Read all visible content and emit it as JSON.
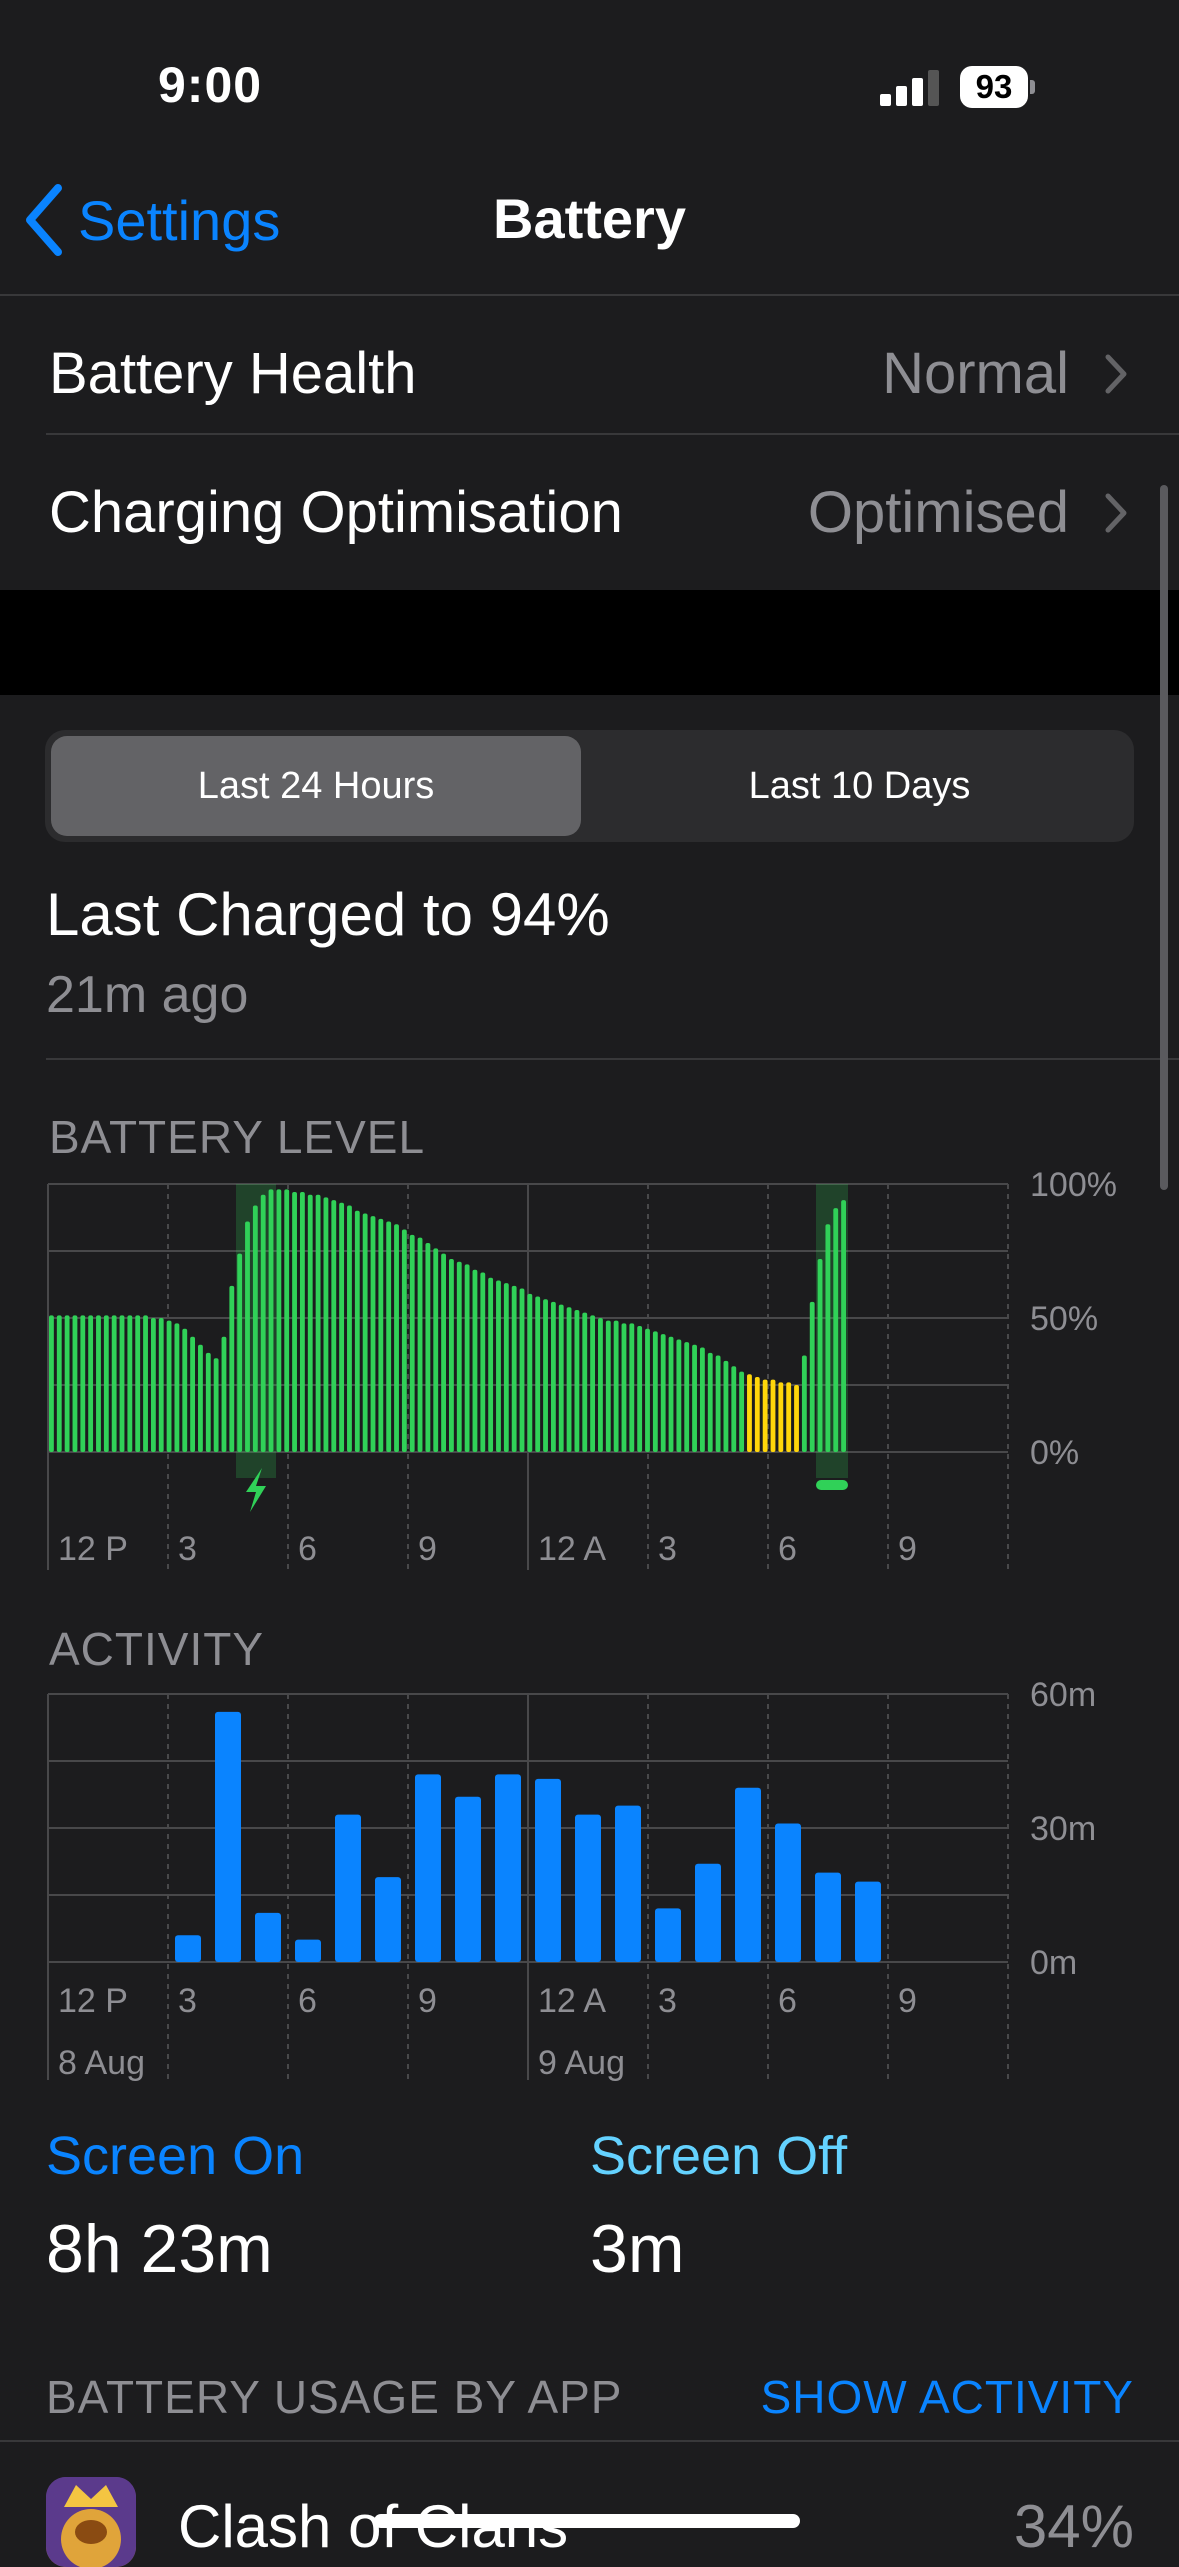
{
  "status_bar": {
    "time": "9:00",
    "battery_percent": "93",
    "signal_bars": 3
  },
  "nav": {
    "back_label": "Settings",
    "title": "Battery"
  },
  "rows": [
    {
      "label": "Battery Health",
      "value": "Normal"
    },
    {
      "label": "Charging Optimisation",
      "value": "Optimised"
    }
  ],
  "segmented": {
    "options": [
      "Last 24 Hours",
      "Last 10 Days"
    ],
    "selected": "Last 24 Hours"
  },
  "last_charged": {
    "title": "Last Charged to 94%",
    "ago": "21m ago"
  },
  "battery_level": {
    "title": "BATTERY LEVEL",
    "y_ticks": [
      "100%",
      "50%",
      "0%"
    ]
  },
  "activity": {
    "title": "ACTIVITY",
    "y_ticks": [
      "60m",
      "30m",
      "0m"
    ]
  },
  "x_ticks": [
    "12 P",
    "3",
    "6",
    "9",
    "12 A",
    "3",
    "6",
    "9"
  ],
  "dates": [
    "8 Aug",
    "9 Aug"
  ],
  "screen_on": {
    "label": "Screen On",
    "value": "8h 23m"
  },
  "screen_off": {
    "label": "Screen Off",
    "value": "3m"
  },
  "usage": {
    "title": "BATTERY USAGE BY APP",
    "action": "SHOW ACTIVITY"
  },
  "apps": [
    {
      "name": "Clash of Clans",
      "percent": "34%"
    }
  ],
  "colors": {
    "accent": "#0a84ff",
    "battery_green": "#30d158",
    "low_power_yellow": "#ffd60a",
    "activity_blue": "#0a84ff",
    "screen_off_cyan": "#64d2ff"
  },
  "chart_data": [
    {
      "type": "bar",
      "title": "BATTERY LEVEL",
      "y_ticks": [
        "100%",
        "50%",
        "0%"
      ],
      "ylim": [
        0,
        100
      ],
      "x_ticks": [
        "12 P",
        "3",
        "6",
        "9",
        "12 A",
        "3",
        "6",
        "9"
      ],
      "charging_periods": [
        [
          4.7,
          5.7
        ],
        [
          19.2,
          20.0
        ]
      ],
      "values": [
        51,
        51,
        51,
        51,
        51,
        51,
        51,
        51,
        51,
        51,
        51,
        51,
        51,
        50,
        50,
        49,
        48,
        46,
        43,
        40,
        37,
        35,
        43,
        62,
        74,
        86,
        92,
        96,
        98,
        98,
        98,
        97,
        97,
        96,
        96,
        95,
        94,
        93,
        92,
        90,
        89,
        88,
        87,
        86,
        85,
        83,
        81,
        80,
        78,
        76,
        74,
        72,
        71,
        70,
        68,
        67,
        65,
        64,
        63,
        62,
        61,
        59,
        58,
        57,
        56,
        55,
        54,
        53,
        52,
        51,
        50,
        49,
        49,
        48,
        48,
        47,
        46,
        45,
        44,
        43,
        42,
        41,
        40,
        39,
        37,
        36,
        34,
        32,
        30,
        29,
        28,
        27,
        27,
        26,
        26,
        25,
        36,
        56,
        72,
        85,
        91,
        94
      ],
      "low_power_range": [
        89,
        96
      ]
    },
    {
      "type": "bar",
      "title": "ACTIVITY",
      "ylim": [
        0,
        60
      ],
      "y_ticks": [
        "60m",
        "30m",
        "0m"
      ],
      "x_ticks": [
        "12 P",
        "3",
        "6",
        "9",
        "12 A",
        "3",
        "6",
        "9"
      ],
      "dates": [
        "8 Aug",
        "9 Aug"
      ],
      "values": [
        0,
        0,
        0,
        6,
        56,
        11,
        5,
        33,
        19,
        42,
        37,
        42,
        41,
        33,
        35,
        12,
        22,
        39,
        31,
        20,
        18
      ]
    }
  ]
}
